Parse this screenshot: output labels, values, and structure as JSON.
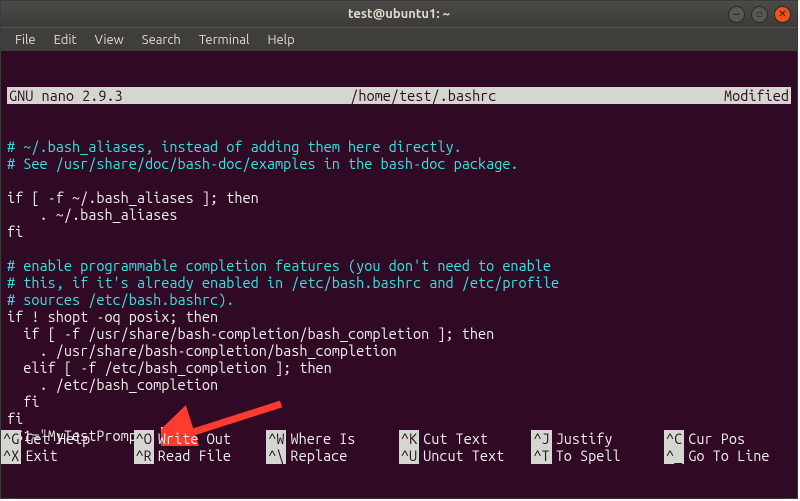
{
  "window": {
    "title": "test@ubuntu1: ~"
  },
  "menubar": [
    "File",
    "Edit",
    "View",
    "Search",
    "Terminal",
    "Help"
  ],
  "nano": {
    "version": "GNU nano 2.9.3",
    "filepath": "/home/test/.bashrc",
    "status": "Modified"
  },
  "content": {
    "l1": "# ~/.bash_aliases, instead of adding them here directly.",
    "l2": "# See /usr/share/doc/bash-doc/examples in the bash-doc package.",
    "l3": "",
    "l4": "if [ -f ~/.bash_aliases ]; then",
    "l5": "    . ~/.bash_aliases",
    "l6": "fi",
    "l7": "",
    "l8": "# enable programmable completion features (you don't need to enable",
    "l9": "# this, if it's already enabled in /etc/bash.bashrc and /etc/profile",
    "l10": "# sources /etc/bash.bashrc).",
    "l11": "if ! shopt -oq posix; then",
    "l12": "  if [ -f /usr/share/bash-completion/bash_completion ]; then",
    "l13": "    . /usr/share/bash-completion/bash_completion",
    "l14": "  elif [ -f /etc/bash_completion ]; then",
    "l15": "    . /etc/bash_completion",
    "l16": "  fi",
    "l17": "fi",
    "l18a": "PS1=\"MyTestPrompt> ",
    "l18b": "\""
  },
  "shortcuts": [
    {
      "key": "^G",
      "label": "Get Help"
    },
    {
      "key": "^O",
      "label": "Write Out"
    },
    {
      "key": "^W",
      "label": "Where Is"
    },
    {
      "key": "^K",
      "label": "Cut Text"
    },
    {
      "key": "^J",
      "label": "Justify"
    },
    {
      "key": "^C",
      "label": "Cur Pos"
    },
    {
      "key": "^X",
      "label": "Exit"
    },
    {
      "key": "^R",
      "label": "Read File"
    },
    {
      "key": "^\\",
      "label": "Replace"
    },
    {
      "key": "^U",
      "label": "Uncut Text"
    },
    {
      "key": "^T",
      "label": "To Spell"
    },
    {
      "key": "^_",
      "label": "Go To Line"
    }
  ]
}
